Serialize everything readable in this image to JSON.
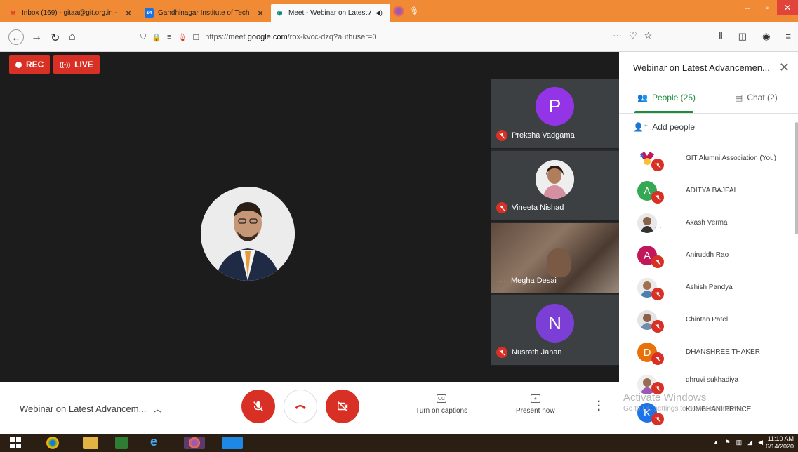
{
  "browser": {
    "tabs": [
      {
        "label": "Inbox (169) - gitaa@git.org.in -",
        "fav": "M",
        "fav_color": "#d93025"
      },
      {
        "label": "Gandhinagar Institute of Techn",
        "fav": "14",
        "fav_color": "#1a73e8"
      },
      {
        "label": "Meet - Webinar on Latest A",
        "fav": "◉",
        "fav_color": "#00897b"
      }
    ],
    "url_prefix": "https://meet.",
    "url_host": "google.com",
    "url_path": "/rox-kvcc-dzq?authuser=0",
    "url_more": "···"
  },
  "meet": {
    "rec_label": "REC",
    "live_label": "LIVE",
    "tiles": [
      {
        "initial": "P",
        "name": "Preksha Vadgama",
        "color": "#9334e6"
      },
      {
        "initial": "",
        "name": "Vineeta Nishad",
        "color": "#c8b9a6"
      },
      {
        "initial": "",
        "name": "Megha Desai",
        "color": "#6b5a4e"
      },
      {
        "initial": "N",
        "name": "Nusrath Jahan",
        "color": "#7b3fd6"
      }
    ],
    "meeting_name": "Webinar on Latest Advancem...",
    "captions_label": "Turn on captions",
    "captions_icon": "CC",
    "present_label": "Present now"
  },
  "panel": {
    "title": "Webinar on Latest Advancemen...",
    "people_tab": "People (25)",
    "chat_tab": "Chat (2)",
    "add_people": "Add people",
    "people": [
      {
        "initial": "",
        "name": "GIT Alumni Association (You)",
        "color": "#ffffff"
      },
      {
        "initial": "A",
        "name": "ADITYA BAJPAI",
        "color": "#34a853"
      },
      {
        "initial": "",
        "name": "Akash Verma",
        "color": "#8d8d8d"
      },
      {
        "initial": "A",
        "name": "Aniruddh Rao",
        "color": "#c2185b"
      },
      {
        "initial": "",
        "name": "Ashish Pandya",
        "color": "#a9a9a9"
      },
      {
        "initial": "",
        "name": "Chintan Patel",
        "color": "#b0b0b0"
      },
      {
        "initial": "D",
        "name": "DHANSHREE THAKER",
        "color": "#e8710a"
      },
      {
        "initial": "",
        "name": "dhruvi sukhadiya",
        "color": "#b39ddb"
      },
      {
        "initial": "K",
        "name": "KUMBHANI PRINCE",
        "color": "#1a73e8"
      }
    ]
  },
  "overlay": {
    "activate_title": "Activate Windows",
    "activate_sub": "Go to PC settings to activate Windows."
  },
  "taskbar": {
    "time": "11:10 AM",
    "date": "6/14/2020"
  }
}
